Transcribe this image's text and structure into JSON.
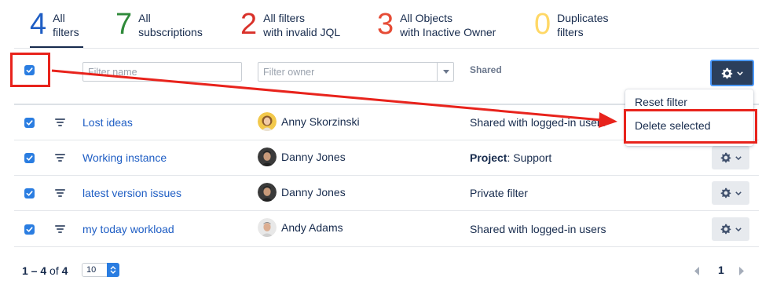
{
  "stats": [
    {
      "count": "4",
      "line1": "All",
      "line2": "filters",
      "color": "#1f5ec4"
    },
    {
      "count": "7",
      "line1": "All",
      "line2": "subscriptions",
      "color": "#2f8a3a"
    },
    {
      "count": "2",
      "line1": "All filters",
      "line2": "with invalid JQL",
      "color": "#d9312a"
    },
    {
      "count": "3",
      "line1": "All Objects",
      "line2": "with Inactive Owner",
      "color": "#e64c36"
    },
    {
      "count": "0",
      "line1": "Duplicates",
      "line2": "filters",
      "color": "#ffd866"
    }
  ],
  "filter_bar": {
    "name_placeholder": "Filter name",
    "owner_placeholder": "Filter owner",
    "shared_header": "Shared"
  },
  "menu": {
    "reset": "Reset filter",
    "delete": "Delete selected"
  },
  "rows": [
    {
      "name": "Lost ideas",
      "owner": "Anny Skorzinski",
      "shared_prefix": "",
      "shared": "Shared with logged-in users"
    },
    {
      "name": "Working instance",
      "owner": "Danny Jones",
      "shared_prefix": "Project",
      "shared": ": Support"
    },
    {
      "name": "latest version issues",
      "owner": "Danny Jones",
      "shared_prefix": "",
      "shared": "Private filter"
    },
    {
      "name": "my today workload",
      "owner": "Andy Adams",
      "shared_prefix": "",
      "shared": "Shared with logged-in users"
    }
  ],
  "footer": {
    "range": "1 – 4",
    "of": "of",
    "total": "4",
    "per_page": "10",
    "page": "1"
  },
  "colors": {
    "accent": "#2a7de1",
    "link": "#1f5ec4",
    "annotation": "#e8231c"
  }
}
